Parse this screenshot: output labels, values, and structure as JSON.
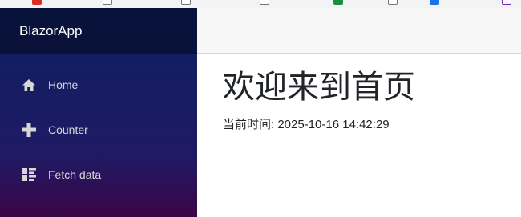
{
  "app": {
    "brand": "BlazorApp"
  },
  "nav": {
    "items": [
      {
        "label": "Home",
        "icon": "home-icon"
      },
      {
        "label": "Counter",
        "icon": "plus-icon"
      },
      {
        "label": "Fetch data",
        "icon": "list-rich-icon"
      }
    ]
  },
  "main": {
    "title": "欢迎来到首页",
    "time_label": "当前时间:",
    "time_value": "2025-10-16 14:42:29"
  },
  "colors": {
    "sidebar_top": "#0c2061",
    "sidebar_bottom": "#3a0647",
    "topbar": "#f7f7f7",
    "nav_text": "#d7d7d7"
  }
}
